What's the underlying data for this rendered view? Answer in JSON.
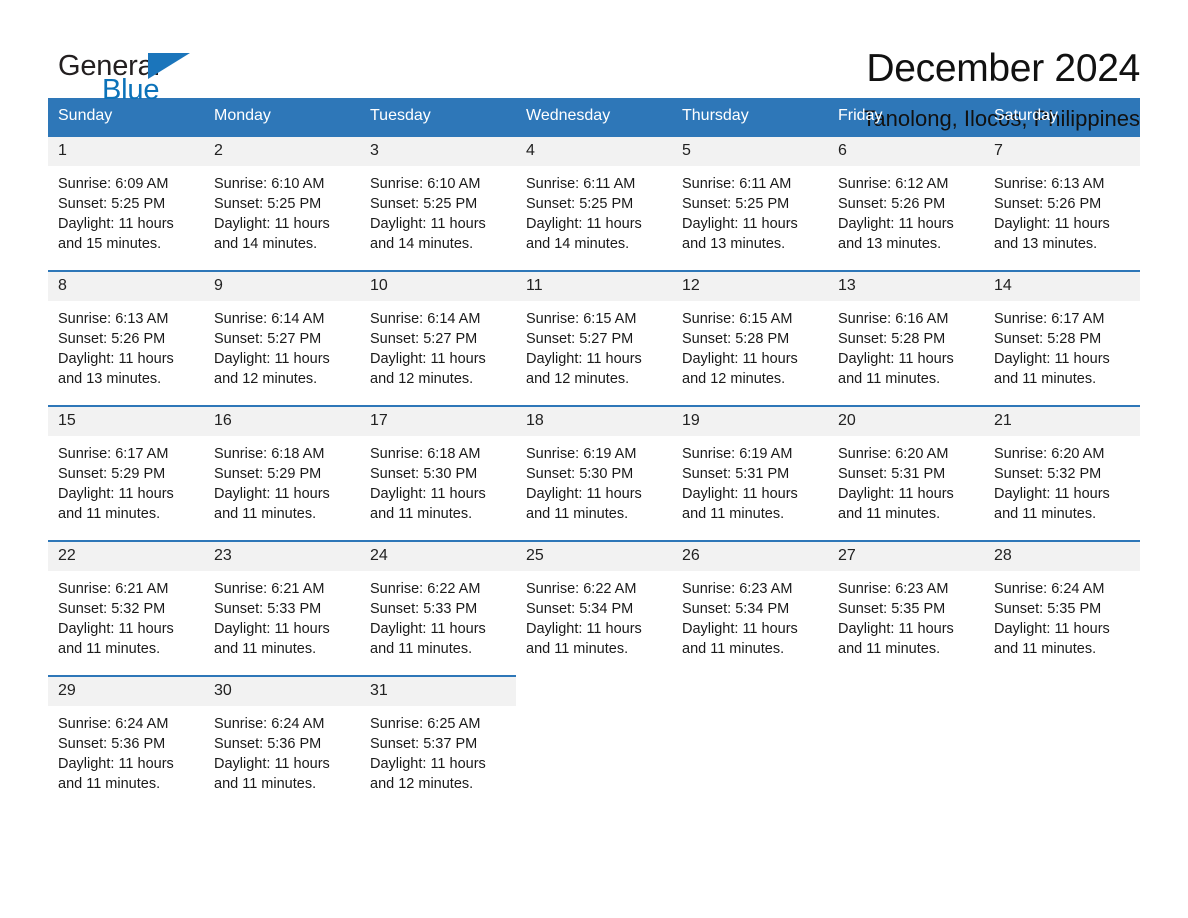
{
  "brand": {
    "word_one": "General",
    "word_two": "Blue",
    "triangle_color": "#1b75bb",
    "text_color": "#231f20",
    "accent_color": "#0b72b9"
  },
  "header": {
    "month_title": "December 2024",
    "location": "Tanolong, Ilocos, Philippines"
  },
  "theme": {
    "header_blue": "#2e77b8",
    "daynum_band": "#f2f2f2",
    "text": "#1a1a1a"
  },
  "calendar": {
    "weekdays": [
      "Sunday",
      "Monday",
      "Tuesday",
      "Wednesday",
      "Thursday",
      "Friday",
      "Saturday"
    ],
    "weeks": [
      [
        {
          "day": "1",
          "sunrise": "Sunrise: 6:09 AM",
          "sunset": "Sunset: 5:25 PM",
          "daylight_line1": "Daylight: 11 hours",
          "daylight_line2": "and 15 minutes."
        },
        {
          "day": "2",
          "sunrise": "Sunrise: 6:10 AM",
          "sunset": "Sunset: 5:25 PM",
          "daylight_line1": "Daylight: 11 hours",
          "daylight_line2": "and 14 minutes."
        },
        {
          "day": "3",
          "sunrise": "Sunrise: 6:10 AM",
          "sunset": "Sunset: 5:25 PM",
          "daylight_line1": "Daylight: 11 hours",
          "daylight_line2": "and 14 minutes."
        },
        {
          "day": "4",
          "sunrise": "Sunrise: 6:11 AM",
          "sunset": "Sunset: 5:25 PM",
          "daylight_line1": "Daylight: 11 hours",
          "daylight_line2": "and 14 minutes."
        },
        {
          "day": "5",
          "sunrise": "Sunrise: 6:11 AM",
          "sunset": "Sunset: 5:25 PM",
          "daylight_line1": "Daylight: 11 hours",
          "daylight_line2": "and 13 minutes."
        },
        {
          "day": "6",
          "sunrise": "Sunrise: 6:12 AM",
          "sunset": "Sunset: 5:26 PM",
          "daylight_line1": "Daylight: 11 hours",
          "daylight_line2": "and 13 minutes."
        },
        {
          "day": "7",
          "sunrise": "Sunrise: 6:13 AM",
          "sunset": "Sunset: 5:26 PM",
          "daylight_line1": "Daylight: 11 hours",
          "daylight_line2": "and 13 minutes."
        }
      ],
      [
        {
          "day": "8",
          "sunrise": "Sunrise: 6:13 AM",
          "sunset": "Sunset: 5:26 PM",
          "daylight_line1": "Daylight: 11 hours",
          "daylight_line2": "and 13 minutes."
        },
        {
          "day": "9",
          "sunrise": "Sunrise: 6:14 AM",
          "sunset": "Sunset: 5:27 PM",
          "daylight_line1": "Daylight: 11 hours",
          "daylight_line2": "and 12 minutes."
        },
        {
          "day": "10",
          "sunrise": "Sunrise: 6:14 AM",
          "sunset": "Sunset: 5:27 PM",
          "daylight_line1": "Daylight: 11 hours",
          "daylight_line2": "and 12 minutes."
        },
        {
          "day": "11",
          "sunrise": "Sunrise: 6:15 AM",
          "sunset": "Sunset: 5:27 PM",
          "daylight_line1": "Daylight: 11 hours",
          "daylight_line2": "and 12 minutes."
        },
        {
          "day": "12",
          "sunrise": "Sunrise: 6:15 AM",
          "sunset": "Sunset: 5:28 PM",
          "daylight_line1": "Daylight: 11 hours",
          "daylight_line2": "and 12 minutes."
        },
        {
          "day": "13",
          "sunrise": "Sunrise: 6:16 AM",
          "sunset": "Sunset: 5:28 PM",
          "daylight_line1": "Daylight: 11 hours",
          "daylight_line2": "and 11 minutes."
        },
        {
          "day": "14",
          "sunrise": "Sunrise: 6:17 AM",
          "sunset": "Sunset: 5:28 PM",
          "daylight_line1": "Daylight: 11 hours",
          "daylight_line2": "and 11 minutes."
        }
      ],
      [
        {
          "day": "15",
          "sunrise": "Sunrise: 6:17 AM",
          "sunset": "Sunset: 5:29 PM",
          "daylight_line1": "Daylight: 11 hours",
          "daylight_line2": "and 11 minutes."
        },
        {
          "day": "16",
          "sunrise": "Sunrise: 6:18 AM",
          "sunset": "Sunset: 5:29 PM",
          "daylight_line1": "Daylight: 11 hours",
          "daylight_line2": "and 11 minutes."
        },
        {
          "day": "17",
          "sunrise": "Sunrise: 6:18 AM",
          "sunset": "Sunset: 5:30 PM",
          "daylight_line1": "Daylight: 11 hours",
          "daylight_line2": "and 11 minutes."
        },
        {
          "day": "18",
          "sunrise": "Sunrise: 6:19 AM",
          "sunset": "Sunset: 5:30 PM",
          "daylight_line1": "Daylight: 11 hours",
          "daylight_line2": "and 11 minutes."
        },
        {
          "day": "19",
          "sunrise": "Sunrise: 6:19 AM",
          "sunset": "Sunset: 5:31 PM",
          "daylight_line1": "Daylight: 11 hours",
          "daylight_line2": "and 11 minutes."
        },
        {
          "day": "20",
          "sunrise": "Sunrise: 6:20 AM",
          "sunset": "Sunset: 5:31 PM",
          "daylight_line1": "Daylight: 11 hours",
          "daylight_line2": "and 11 minutes."
        },
        {
          "day": "21",
          "sunrise": "Sunrise: 6:20 AM",
          "sunset": "Sunset: 5:32 PM",
          "daylight_line1": "Daylight: 11 hours",
          "daylight_line2": "and 11 minutes."
        }
      ],
      [
        {
          "day": "22",
          "sunrise": "Sunrise: 6:21 AM",
          "sunset": "Sunset: 5:32 PM",
          "daylight_line1": "Daylight: 11 hours",
          "daylight_line2": "and 11 minutes."
        },
        {
          "day": "23",
          "sunrise": "Sunrise: 6:21 AM",
          "sunset": "Sunset: 5:33 PM",
          "daylight_line1": "Daylight: 11 hours",
          "daylight_line2": "and 11 minutes."
        },
        {
          "day": "24",
          "sunrise": "Sunrise: 6:22 AM",
          "sunset": "Sunset: 5:33 PM",
          "daylight_line1": "Daylight: 11 hours",
          "daylight_line2": "and 11 minutes."
        },
        {
          "day": "25",
          "sunrise": "Sunrise: 6:22 AM",
          "sunset": "Sunset: 5:34 PM",
          "daylight_line1": "Daylight: 11 hours",
          "daylight_line2": "and 11 minutes."
        },
        {
          "day": "26",
          "sunrise": "Sunrise: 6:23 AM",
          "sunset": "Sunset: 5:34 PM",
          "daylight_line1": "Daylight: 11 hours",
          "daylight_line2": "and 11 minutes."
        },
        {
          "day": "27",
          "sunrise": "Sunrise: 6:23 AM",
          "sunset": "Sunset: 5:35 PM",
          "daylight_line1": "Daylight: 11 hours",
          "daylight_line2": "and 11 minutes."
        },
        {
          "day": "28",
          "sunrise": "Sunrise: 6:24 AM",
          "sunset": "Sunset: 5:35 PM",
          "daylight_line1": "Daylight: 11 hours",
          "daylight_line2": "and 11 minutes."
        }
      ],
      [
        {
          "day": "29",
          "sunrise": "Sunrise: 6:24 AM",
          "sunset": "Sunset: 5:36 PM",
          "daylight_line1": "Daylight: 11 hours",
          "daylight_line2": "and 11 minutes."
        },
        {
          "day": "30",
          "sunrise": "Sunrise: 6:24 AM",
          "sunset": "Sunset: 5:36 PM",
          "daylight_line1": "Daylight: 11 hours",
          "daylight_line2": "and 11 minutes."
        },
        {
          "day": "31",
          "sunrise": "Sunrise: 6:25 AM",
          "sunset": "Sunset: 5:37 PM",
          "daylight_line1": "Daylight: 11 hours",
          "daylight_line2": "and 12 minutes."
        },
        {
          "day": "",
          "sunrise": "",
          "sunset": "",
          "daylight_line1": "",
          "daylight_line2": ""
        },
        {
          "day": "",
          "sunrise": "",
          "sunset": "",
          "daylight_line1": "",
          "daylight_line2": ""
        },
        {
          "day": "",
          "sunrise": "",
          "sunset": "",
          "daylight_line1": "",
          "daylight_line2": ""
        },
        {
          "day": "",
          "sunrise": "",
          "sunset": "",
          "daylight_line1": "",
          "daylight_line2": ""
        }
      ]
    ]
  }
}
